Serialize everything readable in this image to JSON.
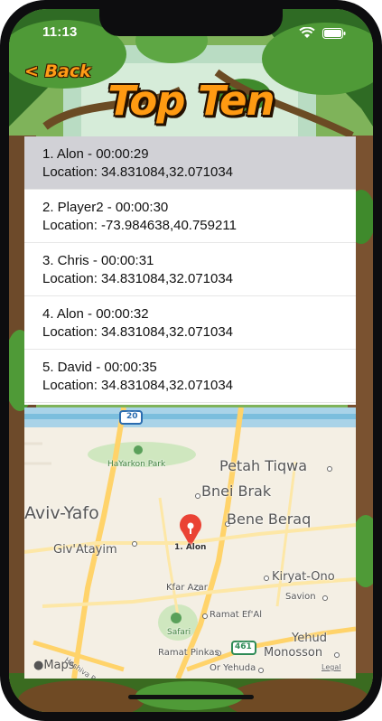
{
  "status_bar": {
    "time": "11:13"
  },
  "nav": {
    "back_label": "< Back",
    "title": "Top Ten"
  },
  "scores": [
    {
      "line1": "1. Alon - 00:00:29",
      "line2": "Location: 34.831084,32.071034",
      "selected": true
    },
    {
      "line1": "2. Player2 - 00:00:30",
      "line2": "Location: -73.984638,40.759211",
      "selected": false
    },
    {
      "line1": "3. Chris - 00:00:31",
      "line2": "Location: 34.831084,32.071034",
      "selected": false
    },
    {
      "line1": "4. Alon - 00:00:32",
      "line2": "Location: 34.831084,32.071034",
      "selected": false
    },
    {
      "line1": "5. David - 00:00:35",
      "line2": "Location: 34.831084,32.071034",
      "selected": false
    }
  ],
  "map": {
    "places": {
      "tel_aviv": "Aviv-Yafo",
      "petah_tiqwa": "Petah Tiqwa",
      "bnei_brak": "Bnei Brak",
      "bene_beraq": "Bene Beraq",
      "givatayim": "Giv'Atayim",
      "kiryat_ono": "Kiryat-Ono",
      "savion": "Savion",
      "kfar_azar": "Kfar Azar",
      "ramat_efal": "Ramat Ef'Al",
      "yehud": "Yehud",
      "monosson": "Monosson",
      "ramat_pinkas": "Ramat Pinkas",
      "or_yehuda": "Or Yehuda",
      "hayarkon_park": "HaYarkon Park",
      "safari": "Safari",
      "hashiva": "Hashiva Ro"
    },
    "shields": {
      "top": "20",
      "bottom": "461"
    },
    "pin_label": "1. Alon",
    "attribution": "Maps",
    "legal": "Legal"
  },
  "colors": {
    "accent_orange": "#ff9a12",
    "selected_row": "#d1d1d6",
    "pin_red": "#ea4335"
  }
}
